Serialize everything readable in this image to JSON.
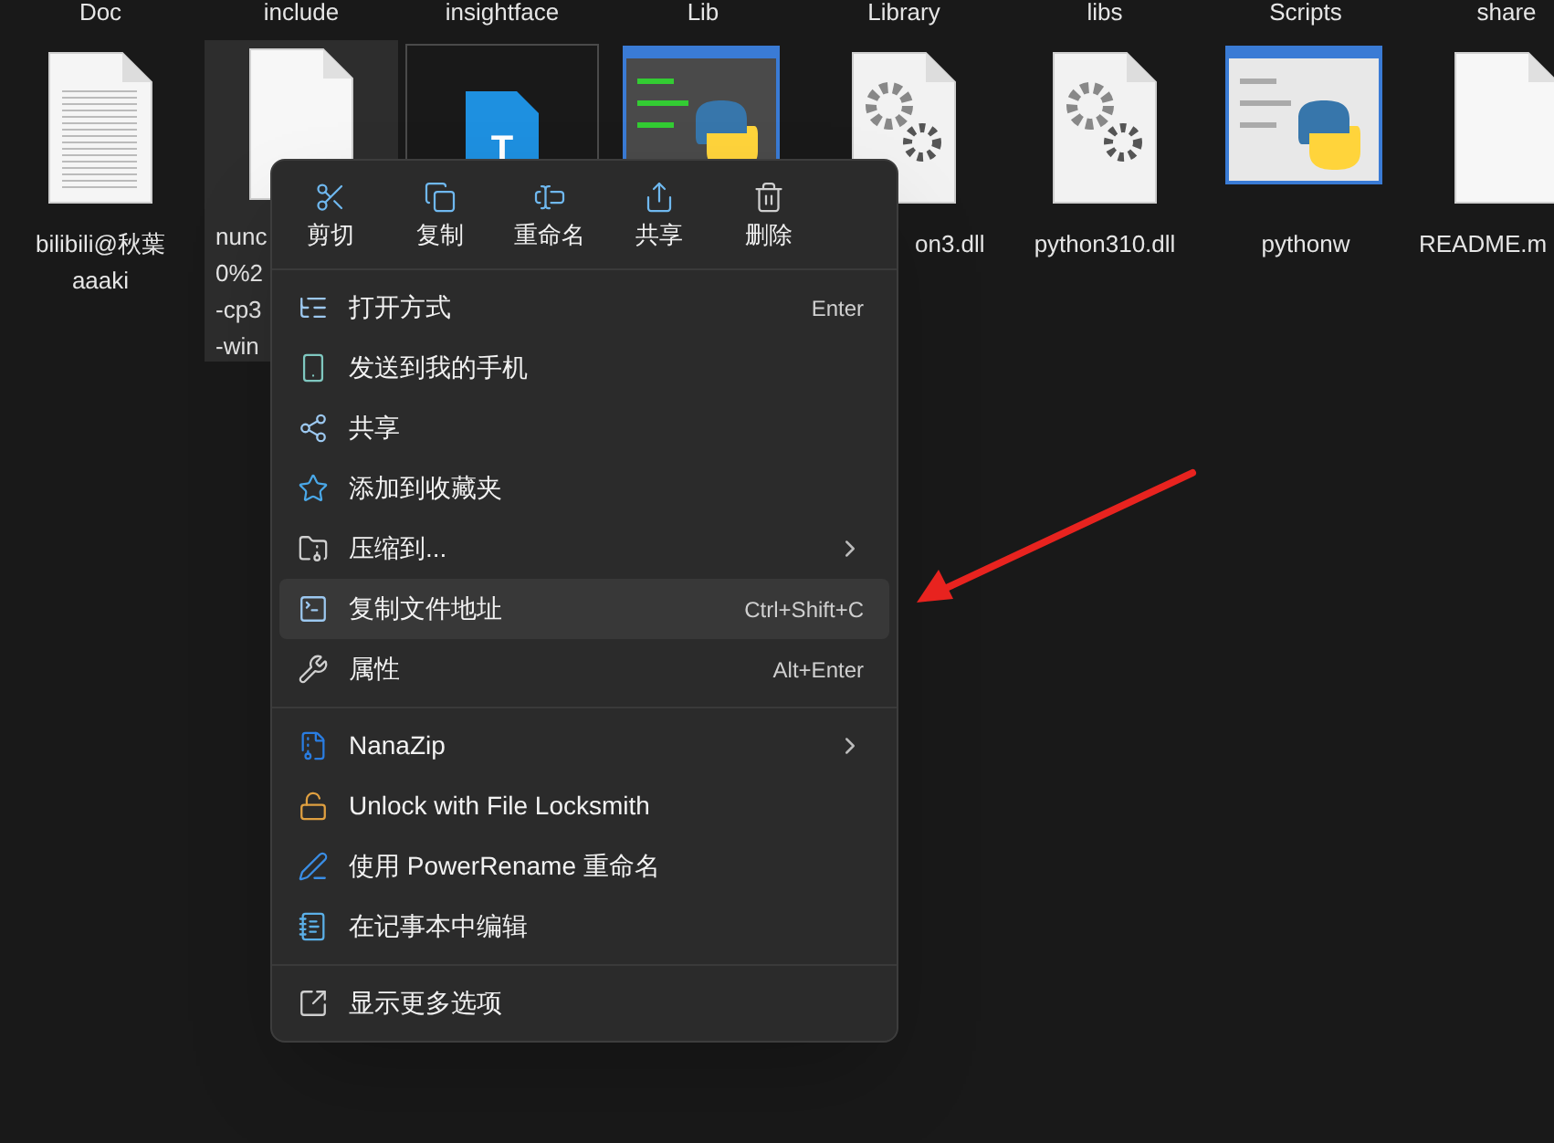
{
  "folders": [
    "Doc",
    "include",
    "insightface",
    "Lib",
    "Library",
    "libs",
    "Scripts",
    "share"
  ],
  "files": [
    {
      "kind": "text",
      "label_lines": [
        "bilibili@秋葉",
        "aaaki"
      ],
      "selected": false,
      "focused": false
    },
    {
      "kind": "blank",
      "label_lines": [
        "nunc",
        "0%2",
        "-cp3",
        "-win"
      ],
      "covered": true,
      "selected": true,
      "focused": false
    },
    {
      "kind": "typora",
      "icon_text": "T",
      "selected": false,
      "focused": true
    },
    {
      "kind": "python-window-dark",
      "selected": false,
      "focused": false
    },
    {
      "kind": "dll",
      "label_lines": [
        "on3.dll"
      ],
      "covered": true,
      "selected": false,
      "focused": false
    },
    {
      "kind": "dll",
      "label_lines": [
        "python310.dll"
      ],
      "selected": false,
      "focused": false
    },
    {
      "kind": "python-window",
      "label_lines": [
        "pythonw"
      ],
      "selected": false,
      "focused": false
    },
    {
      "kind": "blank",
      "label_lines": [
        "README.m"
      ],
      "selected": false,
      "focused": false
    }
  ],
  "context_menu": {
    "actions": [
      "剪切",
      "复制",
      "重命名",
      "共享",
      "删除"
    ],
    "groups": [
      [
        {
          "label": "打开方式",
          "shortcut": "Enter",
          "submenu": false,
          "highlighted": false
        },
        {
          "label": "发送到我的手机",
          "submenu": false,
          "highlighted": false
        },
        {
          "label": "共享",
          "submenu": false,
          "highlighted": false
        },
        {
          "label": "添加到收藏夹",
          "submenu": false,
          "highlighted": false
        },
        {
          "label": "压缩到...",
          "submenu": true,
          "highlighted": false
        },
        {
          "label": "复制文件地址",
          "shortcut": "Ctrl+Shift+C",
          "submenu": false,
          "highlighted": true
        },
        {
          "label": "属性",
          "shortcut": "Alt+Enter",
          "submenu": false,
          "highlighted": false
        }
      ],
      [
        {
          "label": "NanaZip",
          "submenu": true,
          "highlighted": false
        },
        {
          "label": "Unlock with File Locksmith",
          "submenu": false,
          "highlighted": false
        },
        {
          "label": "使用 PowerRename 重命名",
          "submenu": false,
          "highlighted": false
        },
        {
          "label": "在记事本中编辑",
          "submenu": false,
          "highlighted": false
        }
      ],
      [
        {
          "label": "显示更多选项",
          "submenu": false,
          "highlighted": false
        }
      ]
    ]
  }
}
